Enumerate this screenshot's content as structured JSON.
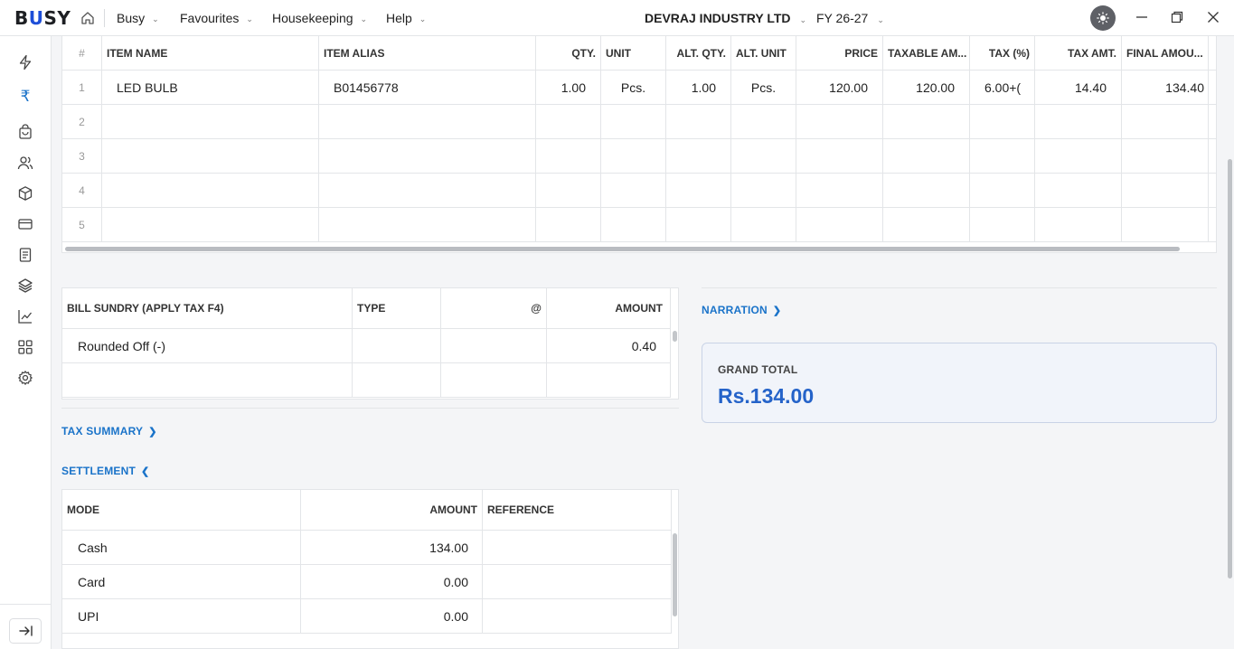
{
  "app": {
    "logo": "BUSY",
    "menus": [
      "Busy",
      "Favourites",
      "Housekeeping",
      "Help"
    ],
    "company": "DEVRAJ INDUSTRY LTD",
    "fiscal_year": "FY 26-27"
  },
  "sidebar": {
    "icons": [
      "lightning-icon",
      "rupee-icon",
      "shopping-bag-icon",
      "users-icon",
      "box-icon",
      "credit-card-icon",
      "document-icon",
      "layers-icon",
      "chart-icon",
      "grid-icon",
      "settings-icon"
    ],
    "collapse_icon": "expand-sidebar-icon"
  },
  "items_grid": {
    "headers": [
      "#",
      "ITEM NAME",
      "ITEM ALIAS",
      "QTY.",
      "UNIT",
      "ALT. QTY.",
      "ALT. UNIT",
      "PRICE",
      "TAXABLE AM...",
      "TAX (%)",
      "TAX AMT.",
      "FINAL AMOU..."
    ],
    "rows": [
      [
        "1",
        "LED BULB",
        "B01456778",
        "1.00",
        "Pcs.",
        "1.00",
        "Pcs.",
        "120.00",
        "120.00",
        "6.00+(",
        "14.40",
        "134.40"
      ],
      [
        "2",
        "",
        "",
        "",
        "",
        "",
        "",
        "",
        "",
        "",
        "",
        ""
      ],
      [
        "3",
        "",
        "",
        "",
        "",
        "",
        "",
        "",
        "",
        "",
        "",
        ""
      ],
      [
        "4",
        "",
        "",
        "",
        "",
        "",
        "",
        "",
        "",
        "",
        "",
        ""
      ],
      [
        "5",
        "",
        "",
        "",
        "",
        "",
        "",
        "",
        "",
        "",
        "",
        ""
      ]
    ]
  },
  "bill_sundry": {
    "headers": [
      "BILL SUNDRY (APPLY TAX F4)",
      "TYPE",
      "@",
      "AMOUNT"
    ],
    "rows": [
      [
        "Rounded Off (-)",
        "",
        "",
        "0.40"
      ],
      [
        "",
        "",
        "",
        ""
      ]
    ]
  },
  "narration_label": "NARRATION",
  "tax_summary_label": "TAX SUMMARY",
  "settlement_label": "SETTLEMENT",
  "grand_total": {
    "label": "GRAND TOTAL",
    "value": "Rs.134.00"
  },
  "settlement": {
    "headers": [
      "MODE",
      "AMOUNT",
      "REFERENCE"
    ],
    "rows": [
      [
        "Cash",
        "134.00",
        ""
      ],
      [
        "Card",
        "0.00",
        ""
      ],
      [
        "UPI",
        "0.00",
        ""
      ]
    ]
  },
  "colors": {
    "accent": "#1a73c9",
    "grand_total": "#2563c9"
  }
}
